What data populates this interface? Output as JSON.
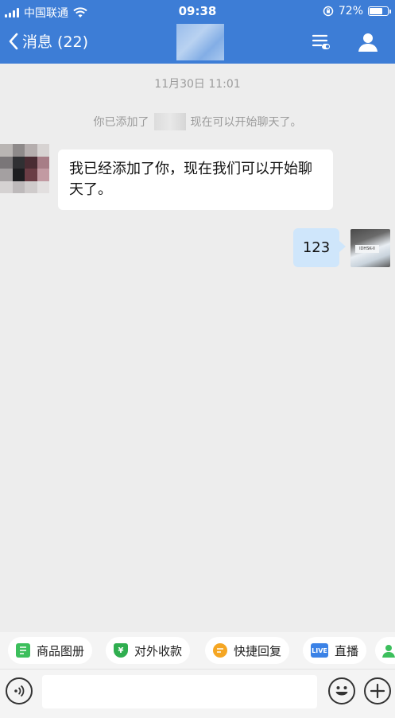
{
  "status_bar": {
    "carrier": "中国联通",
    "time": "09:38",
    "battery_text": "72%",
    "battery_level": 0.72
  },
  "nav": {
    "back_label": "消息 (22)"
  },
  "messages": {
    "timestamp": "11月30日 11:01",
    "system_note_prefix": "你已添加了",
    "system_note_suffix": "现在可以开始聊天了。",
    "incoming_text": "我已经添加了你，现在我们可以开始聊天了。",
    "outgoing_text": "123",
    "outgoing_avatar_tag": "IDHSK-II"
  },
  "quick_actions": [
    {
      "label": "商品图册",
      "icon": "catalog-icon",
      "color": "#3cbf5c"
    },
    {
      "label": "对外收款",
      "icon": "payment-icon",
      "color": "#2fae4f"
    },
    {
      "label": "快捷回复",
      "icon": "quick-reply-icon",
      "color": "#f5a623"
    },
    {
      "label": "直播",
      "icon": "live-icon",
      "color": "#3b82e6"
    }
  ],
  "colors": {
    "header_bg": "#3d7dd6",
    "outgoing_bubble": "#cfe6fb"
  }
}
